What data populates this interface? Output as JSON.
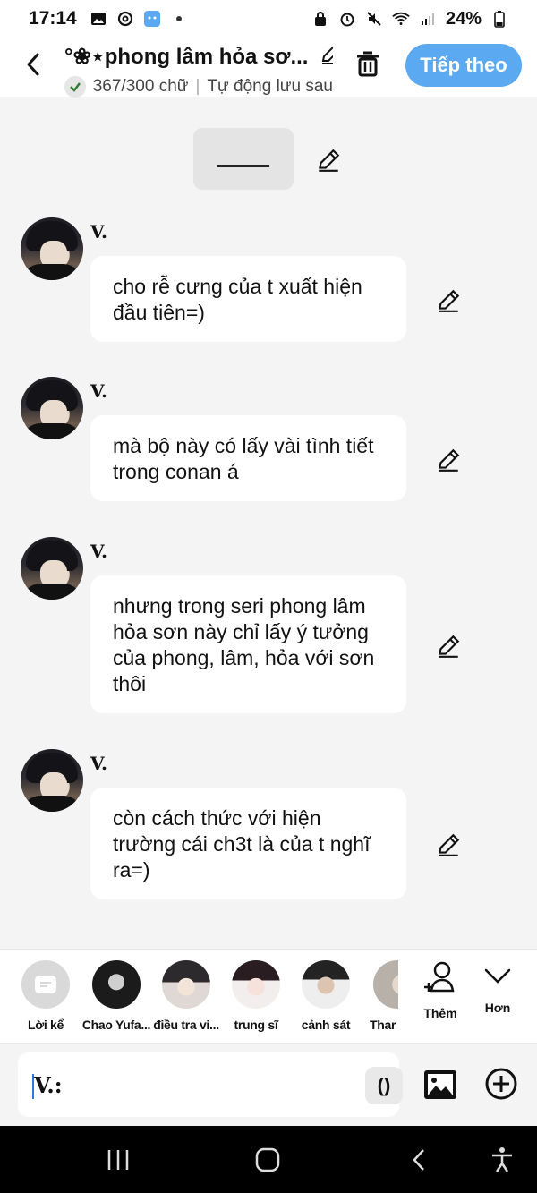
{
  "status_bar": {
    "time": "17:14",
    "battery": "24%",
    "left_icons": [
      "gallery-icon",
      "threads-icon",
      "app-icon",
      "dot-icon"
    ],
    "right_icons": [
      "lock-icon",
      "alarm-icon",
      "mute-icon",
      "wifi-icon",
      "signal-icon",
      "battery-icon"
    ]
  },
  "header": {
    "title": "°❀⋆phong lâm hỏa sơ...",
    "word_count": "367/300 chữ",
    "autosave": "Tự động lưu sau",
    "next_label": "Tiếp theo"
  },
  "messages": [
    {
      "sender": "V.",
      "text": "cho rễ cưng của t xuất hiện đầu tiên=)"
    },
    {
      "sender": "V.",
      "text": "mà bộ này có lấy vài tình tiết trong conan á"
    },
    {
      "sender": "V.",
      "text": "nhưng trong seri phong lâm hỏa sơn này chỉ lấy ý tưởng của phong, lâm, hỏa với sơn thôi"
    },
    {
      "sender": "V.",
      "text": "còn cách thức với hiện trường cái ch3t là của t nghĩ ra=)"
    }
  ],
  "suggestions": [
    {
      "label": "Lời kể"
    },
    {
      "label": "Chao Yufa..."
    },
    {
      "label": "điều tra vi..."
    },
    {
      "label": "trung sĩ"
    },
    {
      "label": "cảnh sát"
    },
    {
      "label": "Thar"
    }
  ],
  "actions": {
    "add_label": "Thêm",
    "more_label": "Hơn"
  },
  "input": {
    "prefix": "V.:",
    "paren_label": "()"
  },
  "colors": {
    "accent": "#5aa9f1",
    "background": "#f4f4f4",
    "bubble": "#ffffff"
  }
}
